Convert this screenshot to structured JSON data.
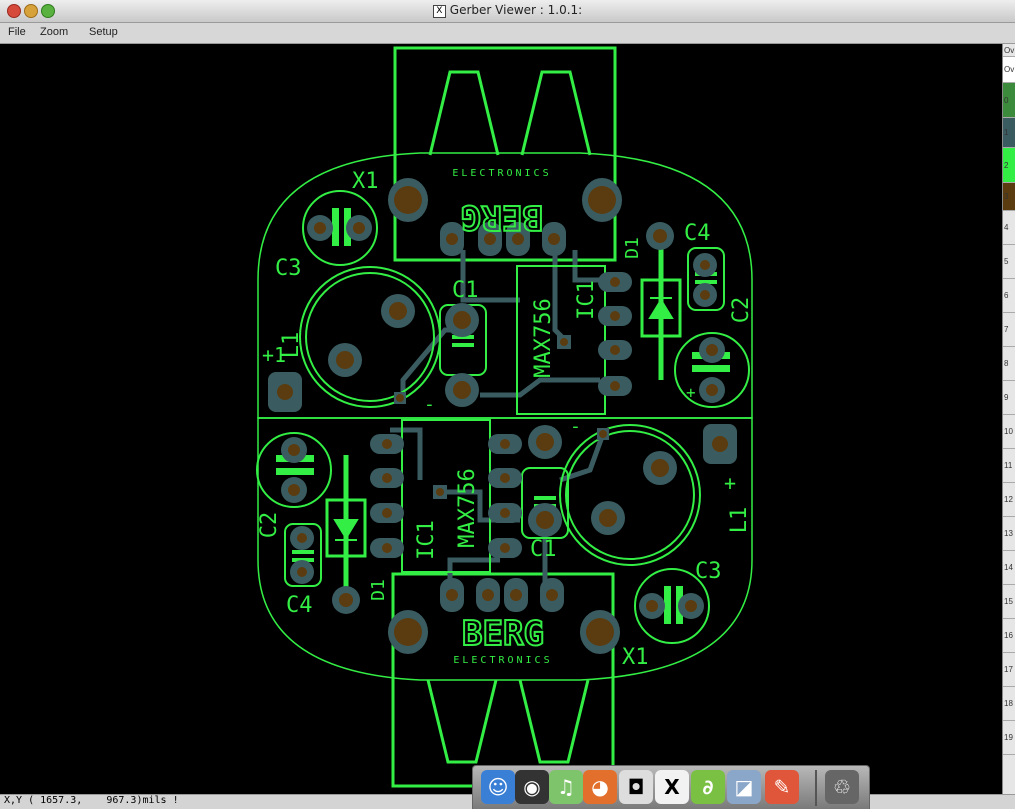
{
  "window": {
    "title": "Gerber Viewer : 1.0.1:",
    "x11_badge": "X"
  },
  "menu": [
    {
      "label": "File"
    },
    {
      "label": "Zoom"
    },
    {
      "label": "Setup"
    }
  ],
  "status": {
    "coordinates": "X,Y ( 1657.3,    967.3)mils !"
  },
  "layers": [
    {
      "label": "Ov",
      "color": "#e6e6e6"
    },
    {
      "label": "Ov",
      "color": "#ffffff"
    },
    {
      "label": "0",
      "color": "#3c8a3c"
    },
    {
      "label": "1",
      "color": "#3a5c60"
    },
    {
      "label": "2",
      "color": "#33ee44"
    },
    {
      "label": "3",
      "color": "#5a3c10"
    },
    {
      "label": "4",
      "color": "#e6e6e6"
    },
    {
      "label": "5",
      "color": "#e6e6e6"
    },
    {
      "label": "6",
      "color": "#e6e6e6"
    },
    {
      "label": "7",
      "color": "#e6e6e6"
    },
    {
      "label": "8",
      "color": "#e6e6e6"
    },
    {
      "label": "9",
      "color": "#e6e6e6"
    },
    {
      "label": "10",
      "color": "#e6e6e6"
    },
    {
      "label": "11",
      "color": "#e6e6e6"
    },
    {
      "label": "12",
      "color": "#e6e6e6"
    },
    {
      "label": "13",
      "color": "#e6e6e6"
    },
    {
      "label": "14",
      "color": "#e6e6e6"
    },
    {
      "label": "15",
      "color": "#e6e6e6"
    },
    {
      "label": "16",
      "color": "#e6e6e6"
    },
    {
      "label": "17",
      "color": "#e6e6e6"
    },
    {
      "label": "18",
      "color": "#e6e6e6"
    },
    {
      "label": "19",
      "color": "#e6e6e6"
    }
  ],
  "pcb": {
    "colors": {
      "silkscreen": "#33ee44",
      "copper": "#3a5c60",
      "drill": "#5a3c10",
      "background": "#000000"
    },
    "top_labels": {
      "x1": "X1",
      "c3": "C3",
      "l1": "L1",
      "plus1": "+1",
      "c1": "C1",
      "ic1": "IC1",
      "max": "MAX756",
      "d1": "D1",
      "c4": "C4",
      "c2": "C2",
      "brand": "BERG",
      "brand_sub": "ELECTRONICS",
      "minus": "-",
      "plus_c2": "+"
    },
    "bottom_labels": {
      "c2": "C2",
      "c4": "C4",
      "d1": "D1",
      "ic1": "IC1",
      "max": "MAX756",
      "c1": "C1",
      "l1": "L1",
      "plus": "+",
      "c3": "C3",
      "x1": "X1",
      "brand": "BERG",
      "brand_sub": "ELECTRONICS",
      "minus": "-"
    }
  },
  "dock": [
    {
      "name": "finder-icon",
      "color": "#3a7fd6",
      "glyph": "☺"
    },
    {
      "name": "dashboard-icon",
      "color": "#333333",
      "glyph": "◉"
    },
    {
      "name": "itunes-icon",
      "color": "#7ec46b",
      "glyph": "♫"
    },
    {
      "name": "firefox-icon",
      "color": "#e2702c",
      "glyph": "◕"
    },
    {
      "name": "apple-icon",
      "color": "#dddddd",
      "glyph": "◘"
    },
    {
      "name": "x11-icon",
      "color": "#f2f2f2",
      "glyph": "X"
    },
    {
      "name": "azureus-icon",
      "color": "#7ac043",
      "glyph": "∂"
    },
    {
      "name": "preview-icon",
      "color": "#8aa6c8",
      "glyph": "◪"
    },
    {
      "name": "pen-icon",
      "color": "#e0563a",
      "glyph": "✎"
    },
    {
      "name": "trash-icon",
      "color": "#666666",
      "glyph": "♲"
    }
  ]
}
